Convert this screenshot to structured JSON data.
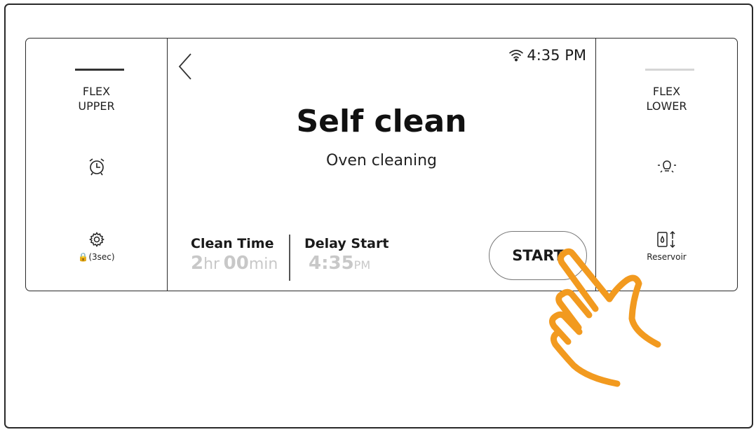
{
  "left_panel": {
    "zone_label_line1": "FLEX",
    "zone_label_line2": "UPPER",
    "lock_label": "🔒(3sec)",
    "icons": [
      "alarm-clock-icon",
      "gear-icon"
    ]
  },
  "right_panel": {
    "zone_label_line1": "FLEX",
    "zone_label_line2": "LOWER",
    "reservoir_label": "Reservoir",
    "icons": [
      "oven-light-icon",
      "reservoir-icon"
    ]
  },
  "status": {
    "time": "4:35 PM",
    "icon": "wifi-icon"
  },
  "main": {
    "title": "Self clean",
    "subtitle": "Oven cleaning",
    "clean_time": {
      "label": "Clean Time",
      "hours": "2",
      "hr_unit": "hr",
      "minutes": "00",
      "min_unit": "min"
    },
    "delay_start": {
      "label": "Delay Start",
      "time": "4:35",
      "period": "PM"
    },
    "start_label": "START"
  },
  "colors": {
    "hand_accent": "#F29A1F",
    "inactive_text": "#C8C8C8"
  }
}
